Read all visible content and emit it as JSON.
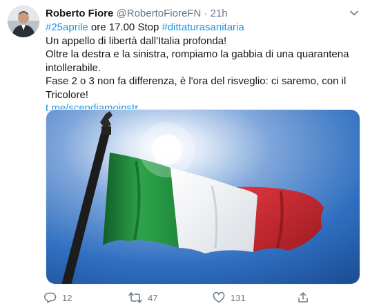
{
  "user": {
    "name": "Roberto Fiore",
    "handle": "@RobertoFioreFN",
    "separator": "·",
    "time": "21h"
  },
  "tweet": {
    "line1": {
      "hashtag1": "#25aprile",
      "mid": " ore 17.00 Stop ",
      "hashtag2": "#dittaturasanitaria"
    },
    "line2": "Un appello di libertà dall'Italia profonda!",
    "line3": "Oltre la destra e la sinistra, rompiamo la gabbia di una quarantena intollerabile.",
    "line4": "Fase 2 o 3 non fa differenza, è l'ora del risveglio: ci saremo, con il Tricolore!",
    "link": "t.me/scendiamoinstr…"
  },
  "actions": {
    "replies": "12",
    "retweets": "47",
    "likes": "131"
  },
  "icons": [
    "avatar",
    "chevron-down-icon",
    "reply-icon",
    "retweet-icon",
    "like-icon",
    "share-icon"
  ],
  "colors": {
    "link": "#1b95e0",
    "secondary_text": "#657786",
    "flag_green": "#1f8a3b",
    "flag_white": "#f2f2f2",
    "flag_red": "#c8242f",
    "sky": "#2f6fc0"
  }
}
